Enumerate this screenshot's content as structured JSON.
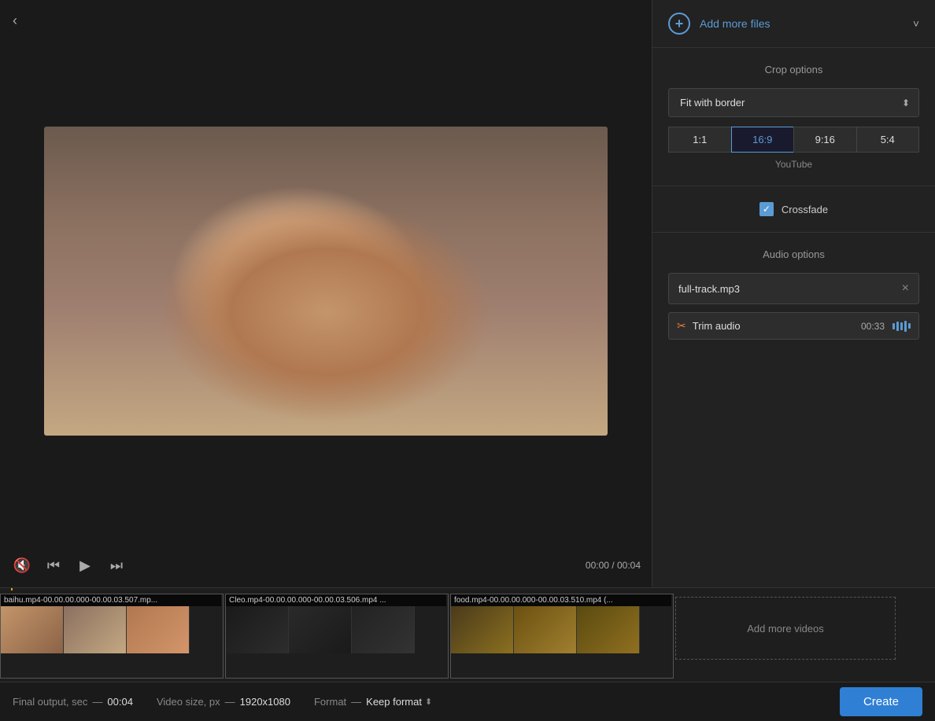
{
  "back_button": "‹",
  "video_preview": {
    "alt": "Cat with cone video preview"
  },
  "controls": {
    "mute_icon": "🔇",
    "prev_icon": "⏮",
    "play_icon": "▶",
    "next_icon": "⏭",
    "current_time": "00:00",
    "separator": "/",
    "total_time": "00:04"
  },
  "right_panel": {
    "add_files_label": "Add more files",
    "expand_icon": "˅",
    "crop_options": {
      "title": "Crop options",
      "select_value": "Fit with border",
      "ratios": [
        {
          "label": "1:1",
          "active": false
        },
        {
          "label": "16:9",
          "active": true
        },
        {
          "label": "9:16",
          "active": false
        },
        {
          "label": "5:4",
          "active": false
        }
      ],
      "youtube_label": "YouTube"
    },
    "crossfade": {
      "label": "Crossfade",
      "checked": true
    },
    "audio_options": {
      "title": "Audio options",
      "filename": "full-track.mp3",
      "clear_icon": "×",
      "trim_label": "Trim audio",
      "trim_duration": "00:33"
    }
  },
  "timeline": {
    "clips": [
      {
        "name": "baihu.mp4-00.00.00.000-00.00.03.507.mp...",
        "thumbs": [
          "thumb-1",
          "thumb-2",
          "thumb-3"
        ]
      },
      {
        "name": "Cleo.mp4-00.00.00.000-00.00.03.506.mp4 ...",
        "thumbs": [
          "thumb-b1",
          "thumb-b2",
          "thumb-b3"
        ]
      },
      {
        "name": "food.mp4-00.00.00.000-00.00.03.510.mp4 (...",
        "thumbs": [
          "thumb-f1",
          "thumb-f2",
          "thumb-f3"
        ]
      }
    ],
    "add_more_label": "Add more videos"
  },
  "bottom_bar": {
    "final_output_label": "Final output, sec",
    "final_output_separator": "—",
    "final_output_value": "00:04",
    "video_size_label": "Video size, px",
    "video_size_separator": "—",
    "video_size_value": "1920x1080",
    "format_label": "Format",
    "format_separator": "—",
    "format_value": "Keep format",
    "create_label": "Create"
  }
}
